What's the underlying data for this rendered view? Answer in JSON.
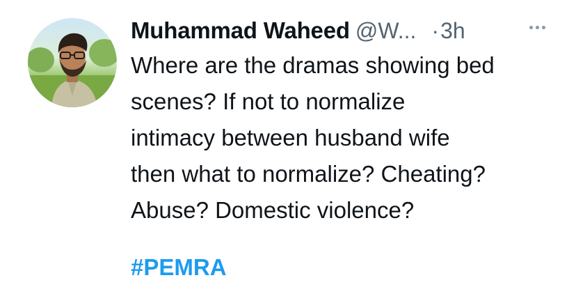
{
  "tweet": {
    "author_name": "Muhammad Waheed",
    "handle": "@W...",
    "separator": "·",
    "time": "3h",
    "more_icon": "ellipsis-icon",
    "avatar_icon": "avatar-photo",
    "text_lines": [
      "Where are the dramas showing bed",
      "scenes? If not to normalize",
      "intimacy between husband wife",
      "then what to normalize? Cheating?",
      "Abuse? Domestic violence?"
    ],
    "hashtag": "#PEMRA",
    "colors": {
      "text": "#0f1419",
      "muted": "#536471",
      "link": "#1d9bf0"
    }
  }
}
